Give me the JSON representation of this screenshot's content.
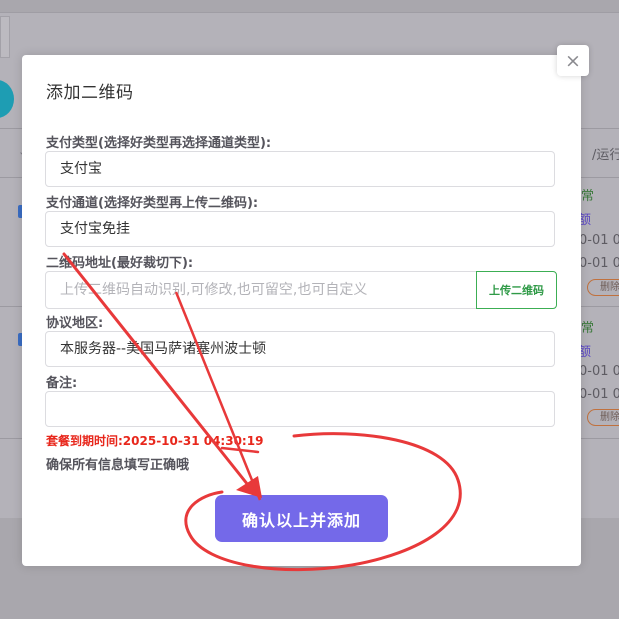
{
  "background": {
    "header_fragment": "/运行",
    "rows": [
      {
        "status": "常",
        "type": "额",
        "time1": "0-01 0",
        "time2": "0-01 0",
        "delete_label": "删除"
      },
      {
        "status": "常",
        "type": "额",
        "time1": "0-01 0",
        "time2": "0-01 0",
        "delete_label": "删除"
      }
    ]
  },
  "modal": {
    "title": "添加二维码",
    "close_icon": "close-icon",
    "fields": {
      "pay_type": {
        "label": "支付类型(选择好类型再选择通道类型):",
        "value": "支付宝"
      },
      "pay_channel": {
        "label": "支付通道(选择好类型再上传二维码):",
        "value": "支付宝免挂"
      },
      "qr_address": {
        "label": "二维码地址(最好裁切下):",
        "placeholder": "上传二维码自动识别,可修改,也可留空,也可自定义",
        "upload_label": "上传二维码"
      },
      "region": {
        "label": "协议地区:",
        "value": "本服务器--美国马萨诸塞州波士顿"
      },
      "remark": {
        "label": "备注:",
        "value": ""
      }
    },
    "expire_text": "套餐到期时间:2025-10-31 04:30:19",
    "notice": "确保所有信息填写正确哦",
    "confirm_label": "确认以上并添加"
  },
  "annotation": {
    "color": "#e8393a",
    "shapes": [
      "arrow",
      "ellipse"
    ]
  },
  "colors": {
    "accent": "#7469e9",
    "upload_green": "#2f9a47",
    "expire_red": "#e8271c"
  }
}
